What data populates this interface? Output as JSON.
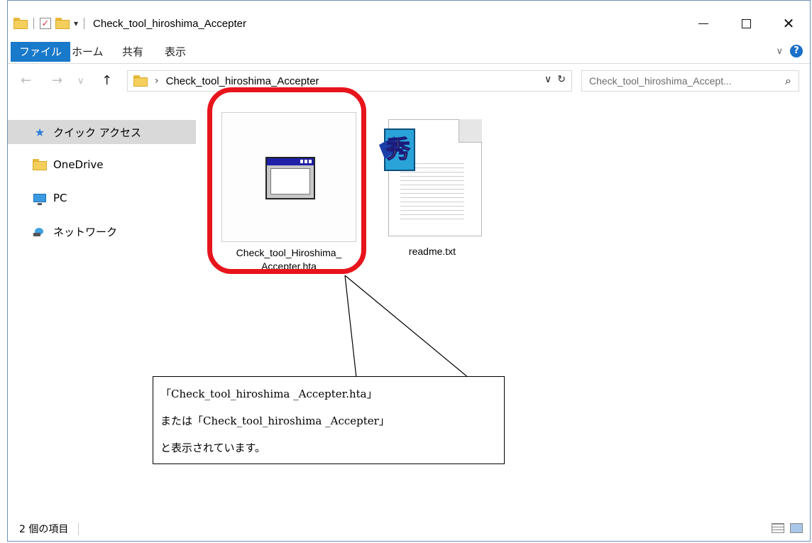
{
  "window": {
    "title": "Check_tool_hiroshima_Accepter",
    "qat_dropdown": "▾",
    "controls": {
      "close_glyph": "✕"
    }
  },
  "ribbon": {
    "tabs": [
      "ファイル",
      "ホーム",
      "共有",
      "表示"
    ],
    "expand_glyph": "∨",
    "help_glyph": "?"
  },
  "nav": {
    "back_glyph": "←",
    "forward_glyph": "→",
    "recent_glyph": "∨",
    "up_glyph": "↑"
  },
  "address": {
    "separator": "›",
    "path": "Check_tool_hiroshima_Accepter",
    "dropdown_glyph": "∨",
    "refresh_glyph": "↻"
  },
  "search": {
    "placeholder": "Check_tool_hiroshima_Accept...",
    "icon_glyph": "⌕"
  },
  "sidebar": {
    "items": [
      {
        "label": "クイック アクセス",
        "icon": "star-icon"
      },
      {
        "label": "OneDrive",
        "icon": "folder-icon"
      },
      {
        "label": "PC",
        "icon": "computer-icon"
      },
      {
        "label": "ネットワーク",
        "icon": "network-icon"
      }
    ]
  },
  "files": [
    {
      "name_line1": "Check_tool_Hiroshima_",
      "name_line2": "Accepter.hta",
      "icon": "hta-application-icon",
      "selected": true
    },
    {
      "name": "readme.txt",
      "icon": "text-document-icon",
      "badge_glyph": "秀"
    }
  ],
  "callout": {
    "line1": "「Check_tool_hiroshima _Accepter.hta」",
    "line2": "または「Check_tool_hiroshima _Accepter」",
    "line3": "と表示されています。"
  },
  "status": {
    "item_count": "2 個の項目"
  },
  "colors": {
    "accent": "#1979ca",
    "highlight": "#e8141c",
    "folder": "#f5cf5c"
  }
}
